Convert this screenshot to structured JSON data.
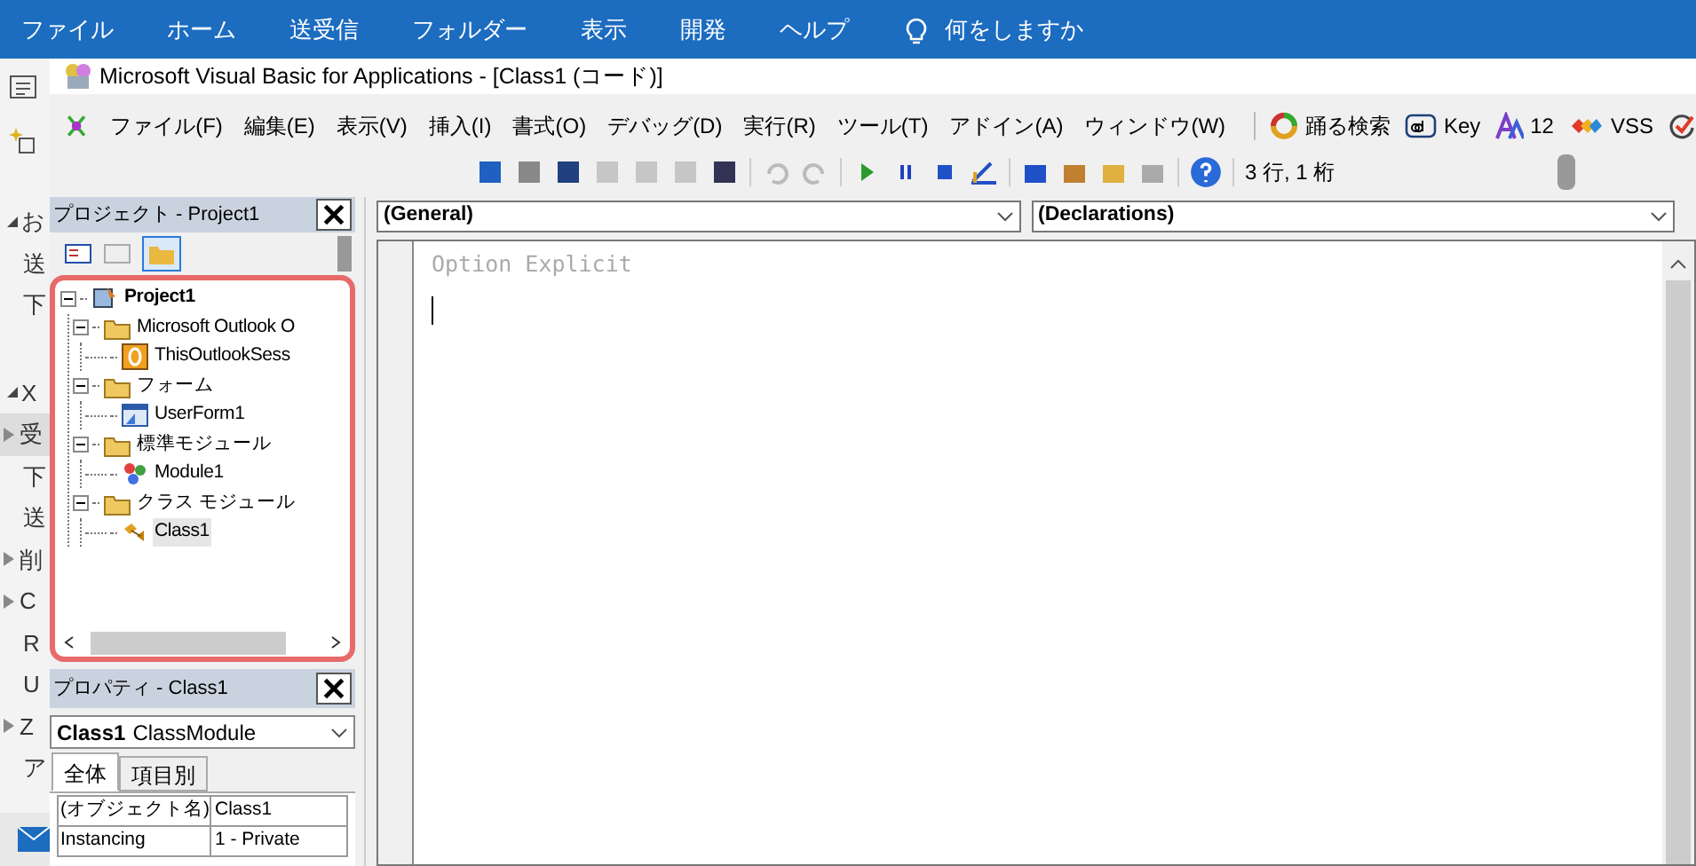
{
  "outlook_ribbon": {
    "tabs": [
      "ファイル",
      "ホーム",
      "送受信",
      "フォルダー",
      "表示",
      "開発",
      "ヘルプ"
    ],
    "tell_me": "何をしますか"
  },
  "outlook_sidebar": [
    {
      "text": "お",
      "kind": "header"
    },
    {
      "text": "送",
      "kind": "item"
    },
    {
      "text": "下",
      "kind": "item"
    },
    {
      "text": "X",
      "kind": "header"
    },
    {
      "text": "受",
      "kind": "collapsed",
      "selected": true
    },
    {
      "text": "下",
      "kind": "item"
    },
    {
      "text": "送",
      "kind": "item"
    },
    {
      "text": "削",
      "kind": "collapsed",
      "selected": false
    },
    {
      "text": "C",
      "kind": "collapsed",
      "selected": false
    },
    {
      "text": "R",
      "kind": "item"
    },
    {
      "text": "U",
      "kind": "item"
    },
    {
      "text": "Z",
      "kind": "collapsed",
      "selected": false
    },
    {
      "text": "ア",
      "kind": "item"
    }
  ],
  "window": {
    "title": "Microsoft Visual Basic for Applications - [Class1 (コード)]"
  },
  "menu": [
    "ファイル(F)",
    "編集(E)",
    "表示(V)",
    "挿入(I)",
    "書式(O)",
    "デバッグ(D)",
    "実行(R)",
    "ツール(T)",
    "アドイン(A)",
    "ウィンドウ(W)"
  ],
  "addin_toolbar": [
    {
      "kind": "search",
      "label": "踊る検索"
    },
    {
      "kind": "key",
      "label": "Key"
    },
    {
      "kind": "font",
      "label": "12"
    },
    {
      "kind": "vss",
      "label": "VSS"
    },
    {
      "kind": "check"
    }
  ],
  "toolbar": {
    "position": "3 行, 1 桁"
  },
  "project_panel": {
    "title": "プロジェクト - Project1",
    "toggle_folders": {
      "selected": true
    },
    "tree": [
      {
        "label": "Project1",
        "kind": "project",
        "expanded": true,
        "selected": false,
        "children": [
          {
            "label": "Microsoft Outlook O",
            "kind": "folder",
            "expanded": true,
            "selected": false,
            "children": [
              {
                "label": "ThisOutlookSess",
                "kind": "outlook",
                "selected": false
              }
            ]
          },
          {
            "label": "フォーム",
            "kind": "folder",
            "expanded": true,
            "selected": false,
            "children": [
              {
                "label": "UserForm1",
                "kind": "form",
                "selected": false
              }
            ]
          },
          {
            "label": "標準モジュール",
            "kind": "folder",
            "expanded": true,
            "selected": false,
            "children": [
              {
                "label": "Module1",
                "kind": "module",
                "selected": false
              }
            ]
          },
          {
            "label": "クラス モジュール",
            "kind": "folder",
            "expanded": true,
            "selected": false,
            "children": [
              {
                "label": "Class1",
                "kind": "class",
                "selected": true
              }
            ]
          }
        ]
      }
    ]
  },
  "properties_panel": {
    "title": "プロパティ - Class1",
    "object": {
      "name": "Class1",
      "type": "ClassModule"
    },
    "tabs": [
      {
        "label": "全体",
        "selected": true
      },
      {
        "label": "項目別",
        "selected": false
      }
    ],
    "rows": [
      {
        "name": "(オブジェクト名)",
        "value": "Class1"
      },
      {
        "name": "Instancing",
        "value": "1 - Private"
      }
    ]
  },
  "code": {
    "object_combo": "(General)",
    "procedure_combo": "(Declarations)",
    "lines": [
      "Option Explicit"
    ]
  }
}
